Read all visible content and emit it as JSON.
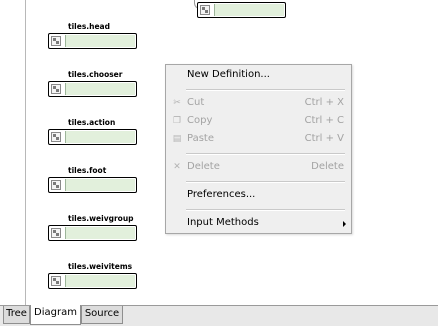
{
  "tree_nodes": [
    {
      "label": ""
    },
    {
      "label": "tiles.head"
    },
    {
      "label": "tiles.chooser"
    },
    {
      "label": "tiles.action"
    },
    {
      "label": "tiles.foot"
    },
    {
      "label": "tiles.weivgroup"
    },
    {
      "label": "tiles.weivitems"
    }
  ],
  "context_menu": {
    "new_definition": "New Definition...",
    "cut": {
      "label": "Cut",
      "shortcut": "Ctrl + X"
    },
    "copy": {
      "label": "Copy",
      "shortcut": "Ctrl + C"
    },
    "paste": {
      "label": "Paste",
      "shortcut": "Ctrl + V"
    },
    "delete": {
      "label": "Delete",
      "shortcut": "Delete"
    },
    "preferences": "Preferences...",
    "input_methods": "Input Methods"
  },
  "tabs": [
    "Tree",
    "Diagram",
    "Source"
  ],
  "active_tab": "Diagram",
  "icons": {
    "node": "image-placeholder-icon",
    "cut": "scissors-icon",
    "copy": "copy-icon",
    "paste": "paste-icon",
    "delete": "delete-x-icon",
    "submenu": "submenu-arrow-icon"
  }
}
